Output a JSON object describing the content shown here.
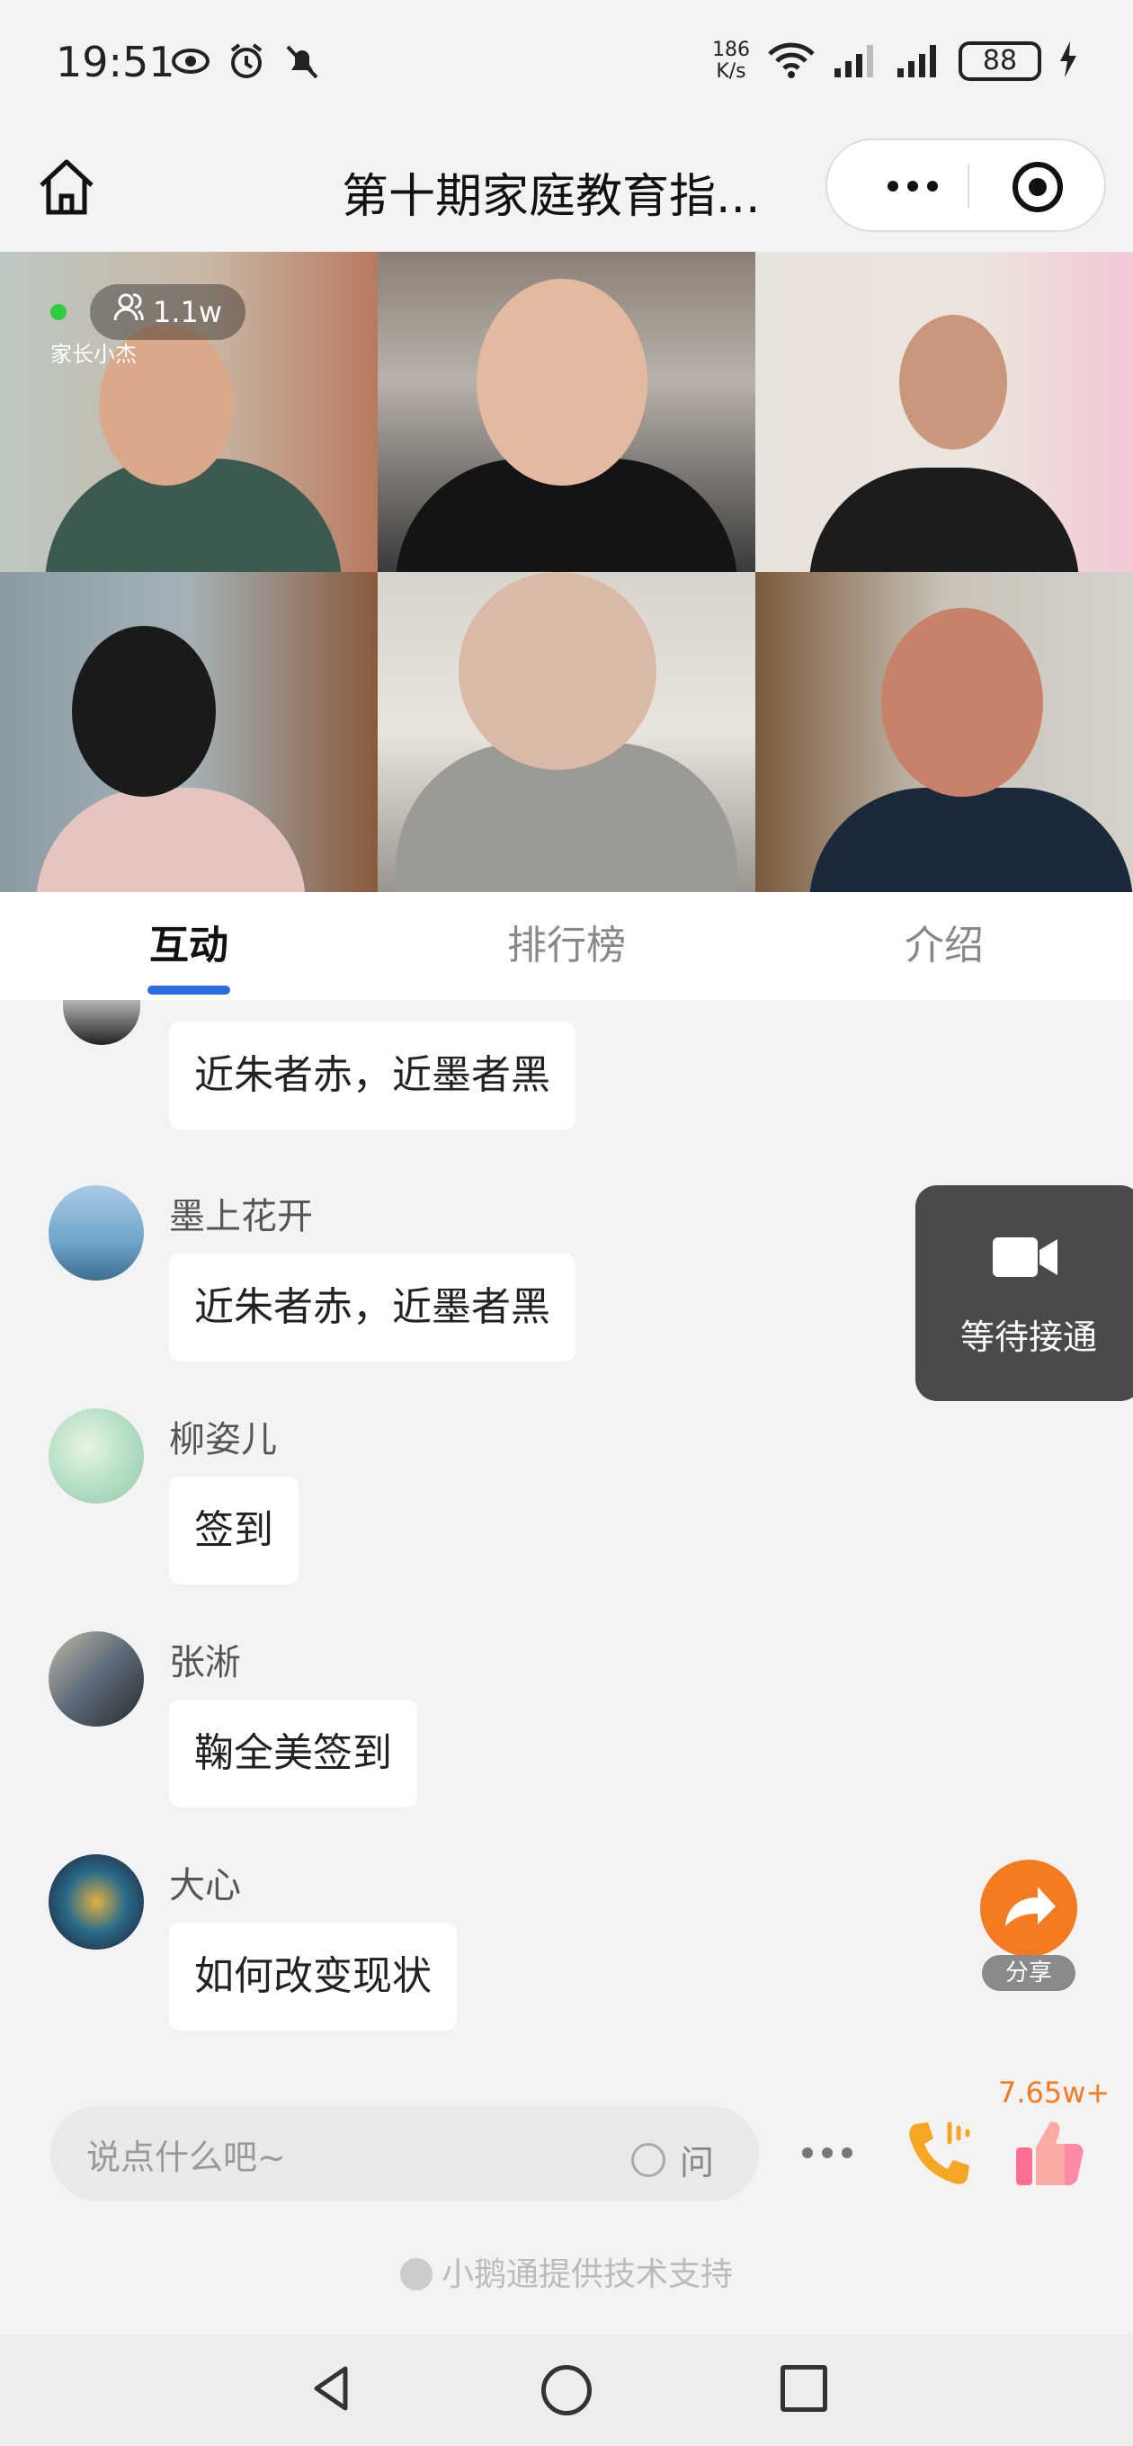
{
  "status_bar": {
    "time": "19:51",
    "net_speed_value": "186",
    "net_speed_unit": "K/s",
    "battery": "88",
    "icons": [
      "eye-icon",
      "alarm-icon",
      "mute-icon",
      "wifi-icon",
      "signal-icon",
      "signal-icon",
      "charging-icon"
    ]
  },
  "header": {
    "title": "第十期家庭教育指...",
    "home_icon": "home-icon",
    "more_icon": "more-icon",
    "close_icon": "record-icon"
  },
  "live": {
    "viewers": "1.1w",
    "host_label": "家长小杰"
  },
  "tabs": [
    {
      "label": "互动",
      "active": true
    },
    {
      "label": "排行榜",
      "active": false
    },
    {
      "label": "介绍",
      "active": false
    }
  ],
  "messages": [
    {
      "name": "",
      "text": "近朱者赤，近墨者黑"
    },
    {
      "name": "墨上花开",
      "text": "近朱者赤，近墨者黑"
    },
    {
      "name": "柳姿儿",
      "text": "签到"
    },
    {
      "name": "张淅",
      "text": "鞠全美签到"
    },
    {
      "name": "大心",
      "text": "如何改变现状"
    }
  ],
  "waiting": {
    "label": "等待接通",
    "icon": "video-camera-icon"
  },
  "share": {
    "label": "分享",
    "icon": "share-arrow-icon"
  },
  "input": {
    "placeholder": "说点什么吧~",
    "ask_label": "问"
  },
  "likes": {
    "count": "7.65w+"
  },
  "powered_by": "小鹅通提供技术支持",
  "colors": {
    "accent": "#2b6be4",
    "share": "#f47b22",
    "like_count": "#f47b22"
  }
}
